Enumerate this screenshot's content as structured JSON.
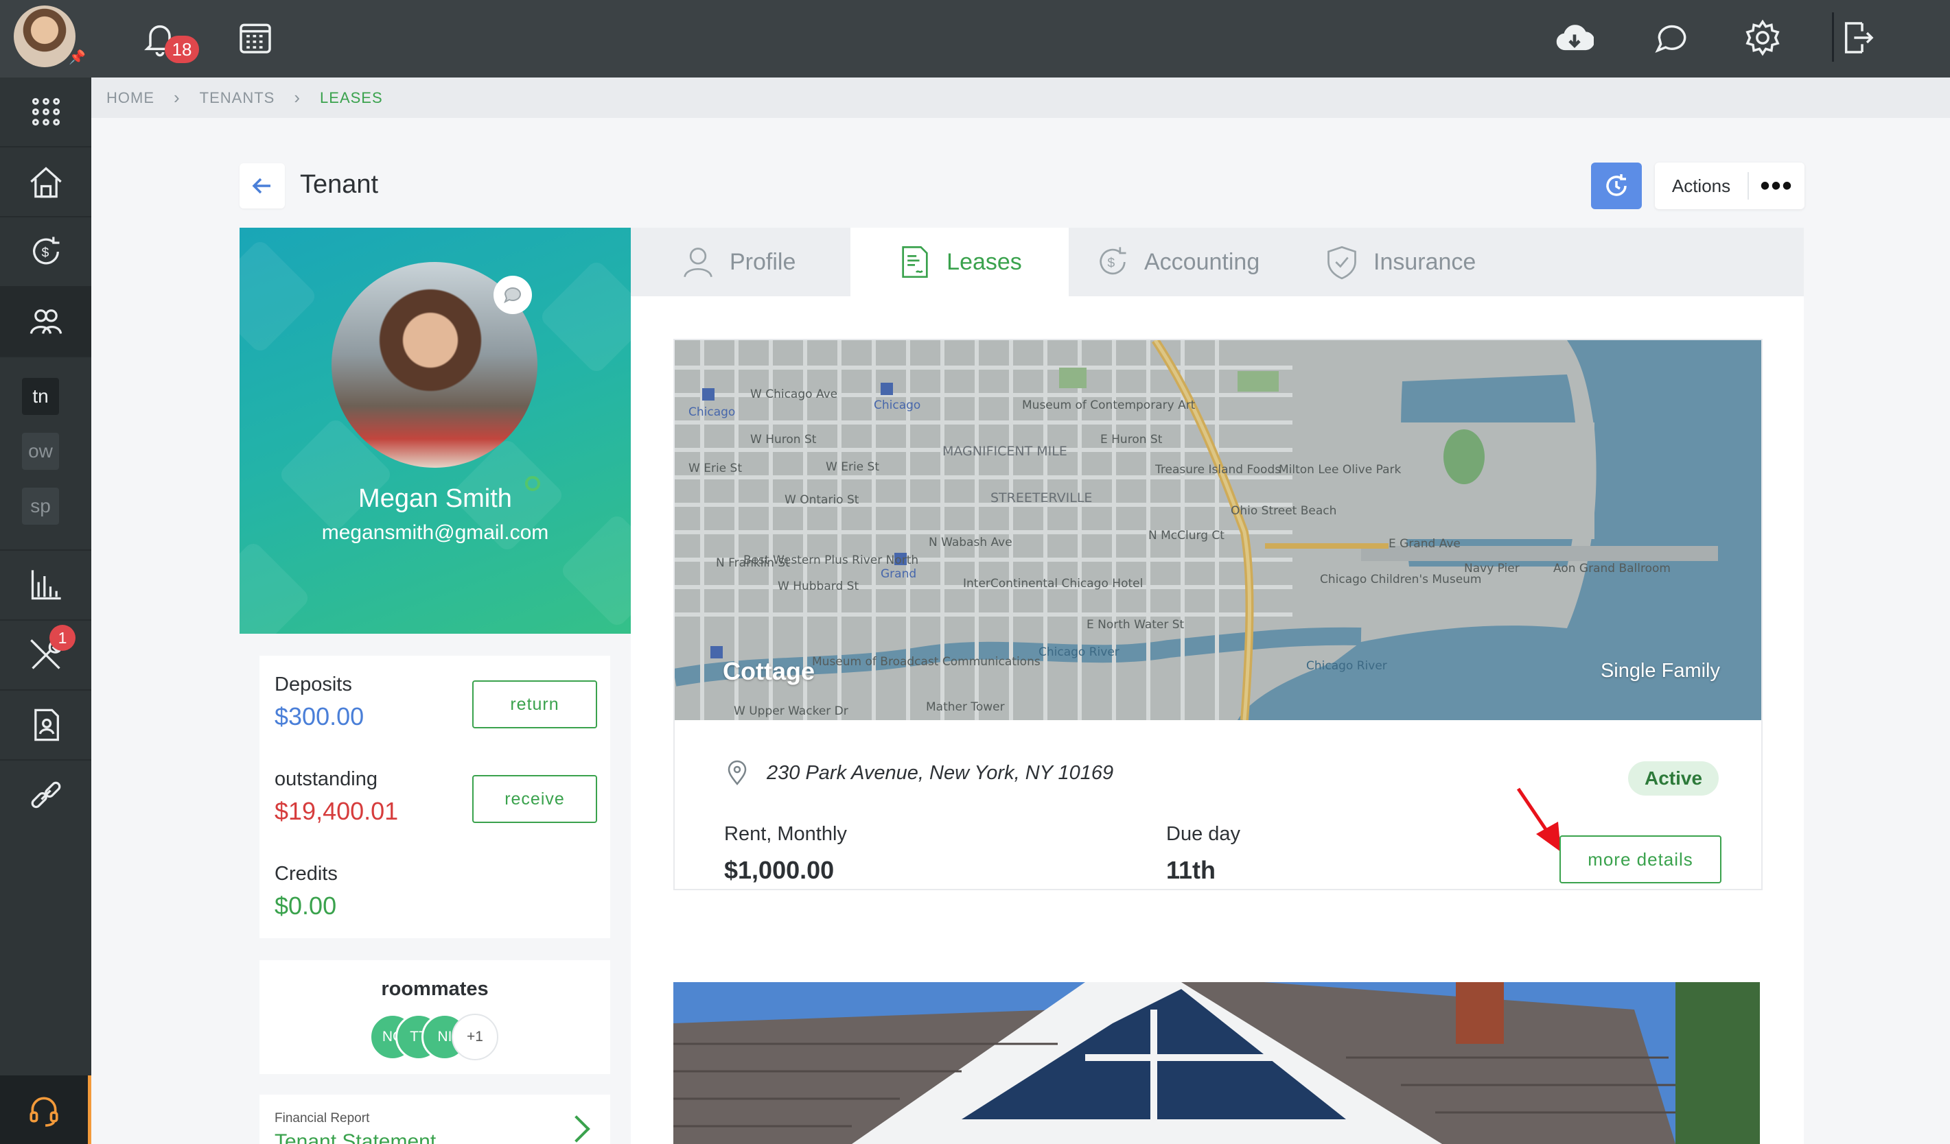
{
  "topbar": {
    "notification_count": "18",
    "icons": [
      "bell-icon",
      "calendar-icon",
      "cloud-download-icon",
      "chat-icon",
      "gear-icon",
      "logout-icon"
    ]
  },
  "sidebar": {
    "chips": [
      "tn",
      "ow",
      "sp"
    ],
    "maintenance_badge": "1",
    "icons": [
      "apps-grid-icon",
      "property-icon",
      "accounting-icon",
      "people-icon",
      "reports-icon",
      "tools-icon",
      "document-icon",
      "link-icon",
      "headset-icon"
    ]
  },
  "breadcrumb": {
    "home": "HOME",
    "tenants": "TENANTS",
    "leases": "LEASES"
  },
  "header": {
    "title": "Tenant",
    "actions_label": "Actions",
    "more": "•••"
  },
  "tenant": {
    "name": "Megan Smith",
    "email": "megansmith@gmail.com"
  },
  "balances": {
    "deposits_label": "Deposits",
    "deposits_value": "$300.00",
    "return_label": "return",
    "outstanding_label": "outstanding",
    "outstanding_value": "$19,400.01",
    "receive_label": "receive",
    "credits_label": "Credits",
    "credits_value": "$0.00"
  },
  "roommates": {
    "title": "roommates",
    "initials": [
      "NC",
      "TT",
      "NI"
    ],
    "more": "+1"
  },
  "financial_report": {
    "subtitle": "Financial Report",
    "title": "Tenant Statement"
  },
  "tabs": [
    {
      "label": "Profile",
      "icon": "user-icon"
    },
    {
      "label": "Leases",
      "icon": "lease-document-icon"
    },
    {
      "label": "Accounting",
      "icon": "money-cycle-icon"
    },
    {
      "label": "Insurance",
      "icon": "shield-icon"
    }
  ],
  "lease": {
    "property_name": "Cottage",
    "property_type": "Single Family",
    "address": "230 Park Avenue, New York, NY 10169",
    "status": "Active",
    "rent_label": "Rent, Monthly",
    "rent_value": "$1,000.00",
    "due_label": "Due day",
    "due_value": "11th",
    "details_label": "more details"
  },
  "map_labels": {
    "streets": [
      "W Chicago Ave",
      "W Huron St",
      "W Erie St",
      "W Erie St",
      "W Ontario St",
      "W Hubbard St",
      "E Huron St",
      "E North Water St",
      "E Grand Ave",
      "W Upper Wacker Dr",
      "N Franklin St",
      "N Wabash Ave",
      "N McClurg Ct",
      "Chicago River",
      "Chicago River"
    ],
    "places": [
      "Chicago",
      "Chicago",
      "Museum of Contemporary Art",
      "MAGNIFICENT MILE",
      "STREETERVILLE",
      "Treasure Island Foods",
      "Milton Lee Olive Park",
      "Ohio Street Beach",
      "Best Western Plus River North",
      "Grand",
      "InterContinental Chicago Hotel",
      "Chicago Children's Museum",
      "Navy Pier",
      "Aon Grand Ballroom",
      "Museum of Broadcast Communications",
      "Mather Tower"
    ]
  },
  "colors": {
    "accent_green": "#3aa24d",
    "deposit_blue": "#4a7fd8",
    "outstanding_red": "#d63c3c",
    "rail": "#2f3537",
    "topbar": "#3c4245"
  }
}
